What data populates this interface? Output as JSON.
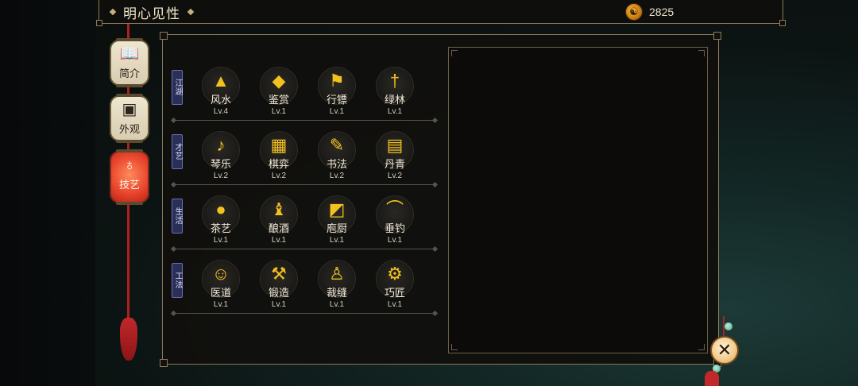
{
  "header": {
    "title": "明心见性",
    "currency_icon": "coin-icon",
    "currency_value": "2825"
  },
  "nav": {
    "items": [
      {
        "label": "简介",
        "icon": "book-icon",
        "active": false
      },
      {
        "label": "外观",
        "icon": "portrait-icon",
        "active": false
      },
      {
        "label": "技艺",
        "icon": "pipa-icon",
        "active": true
      }
    ]
  },
  "skills": {
    "categories": [
      {
        "label": "江湖",
        "items": [
          {
            "name": "风水",
            "level": "Lv.4",
            "icon": "mountain-icon"
          },
          {
            "name": "鉴赏",
            "level": "Lv.1",
            "icon": "jade-gem-icon"
          },
          {
            "name": "行镖",
            "level": "Lv.1",
            "icon": "banner-flag-icon"
          },
          {
            "name": "绿林",
            "level": "Lv.1",
            "icon": "dagger-icon"
          }
        ]
      },
      {
        "label": "才艺",
        "items": [
          {
            "name": "琴乐",
            "level": "Lv.2",
            "icon": "zither-icon"
          },
          {
            "name": "棋弈",
            "level": "Lv.2",
            "icon": "go-board-icon"
          },
          {
            "name": "书法",
            "level": "Lv.2",
            "icon": "brush-icon"
          },
          {
            "name": "丹青",
            "level": "Lv.2",
            "icon": "painting-scroll-icon"
          }
        ]
      },
      {
        "label": "生活",
        "items": [
          {
            "name": "茶艺",
            "level": "Lv.1",
            "icon": "teapot-icon"
          },
          {
            "name": "酿酒",
            "level": "Lv.1",
            "icon": "wine-gourd-icon"
          },
          {
            "name": "庖厨",
            "level": "Lv.1",
            "icon": "cleaver-icon"
          },
          {
            "name": "垂钓",
            "level": "Lv.1",
            "icon": "fishing-rod-icon"
          }
        ]
      },
      {
        "label": "工法",
        "items": [
          {
            "name": "医道",
            "level": "Lv.1",
            "icon": "medicine-icon"
          },
          {
            "name": "锻造",
            "level": "Lv.1",
            "icon": "anvil-icon"
          },
          {
            "name": "裁缝",
            "level": "Lv.1",
            "icon": "robe-icon"
          },
          {
            "name": "巧匠",
            "level": "Lv.1",
            "icon": "hammer-icon"
          }
        ]
      }
    ]
  },
  "close": {
    "icon": "close-icon"
  }
}
